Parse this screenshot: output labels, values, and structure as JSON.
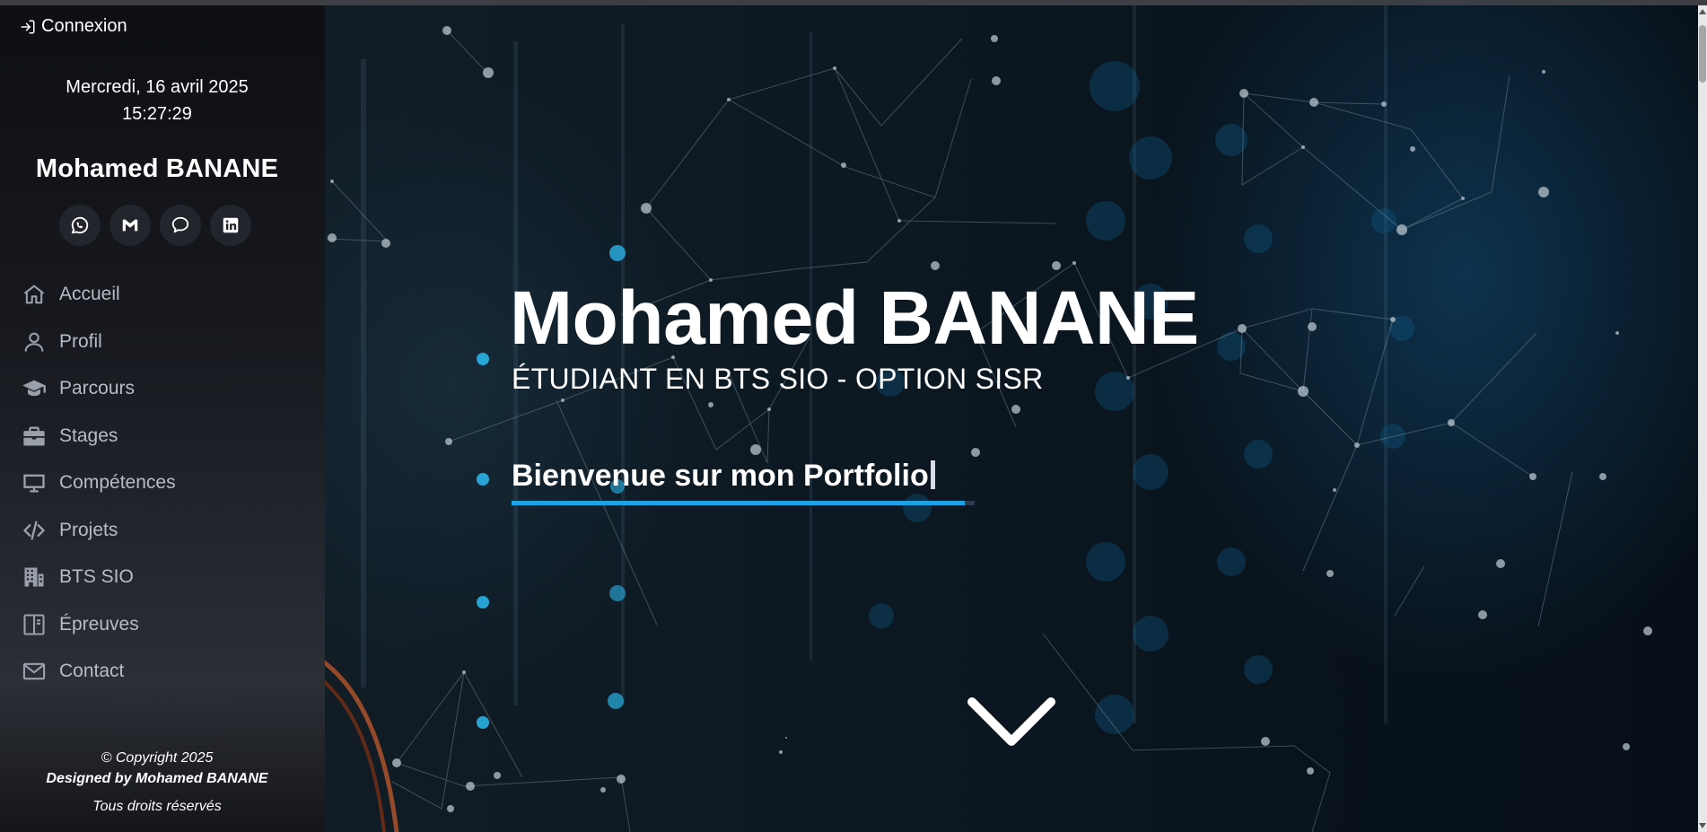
{
  "sidebar": {
    "login_label": "Connexion",
    "date": "Mercredi, 16 avril 2025",
    "time": "15:27:29",
    "name": "Mohamed BANANE",
    "socials": [
      {
        "icon": "whatsapp-icon"
      },
      {
        "icon": "gmail-icon"
      },
      {
        "icon": "chat-icon"
      },
      {
        "icon": "linkedin-icon"
      }
    ],
    "nav": [
      {
        "label": "Accueil",
        "icon": "home-icon"
      },
      {
        "label": "Profil",
        "icon": "user-icon"
      },
      {
        "label": "Parcours",
        "icon": "graduation-cap-icon"
      },
      {
        "label": "Stages",
        "icon": "briefcase-icon"
      },
      {
        "label": "Compétences",
        "icon": "monitor-icon"
      },
      {
        "label": "Projets",
        "icon": "code-icon"
      },
      {
        "label": "BTS SIO",
        "icon": "building-icon"
      },
      {
        "label": "Épreuves",
        "icon": "book-icon"
      },
      {
        "label": "Contact",
        "icon": "mail-icon"
      }
    ],
    "footer": {
      "copyright": "© Copyright 2025",
      "designed": "Designed by Mohamed BANANE",
      "rights": "Tous droits réservés"
    }
  },
  "hero": {
    "title": "Mohamed BANANE",
    "subtitle": "ÉTUDIANT EN BTS SIO - OPTION SISR",
    "welcome": "Bienvenue sur mon Portfolio",
    "scroll_icon": "chevron-down-icon"
  },
  "colors": {
    "accent": "#1da2e6",
    "sidebar_bg": "#17191f",
    "hero_bg": "#0b1620"
  }
}
